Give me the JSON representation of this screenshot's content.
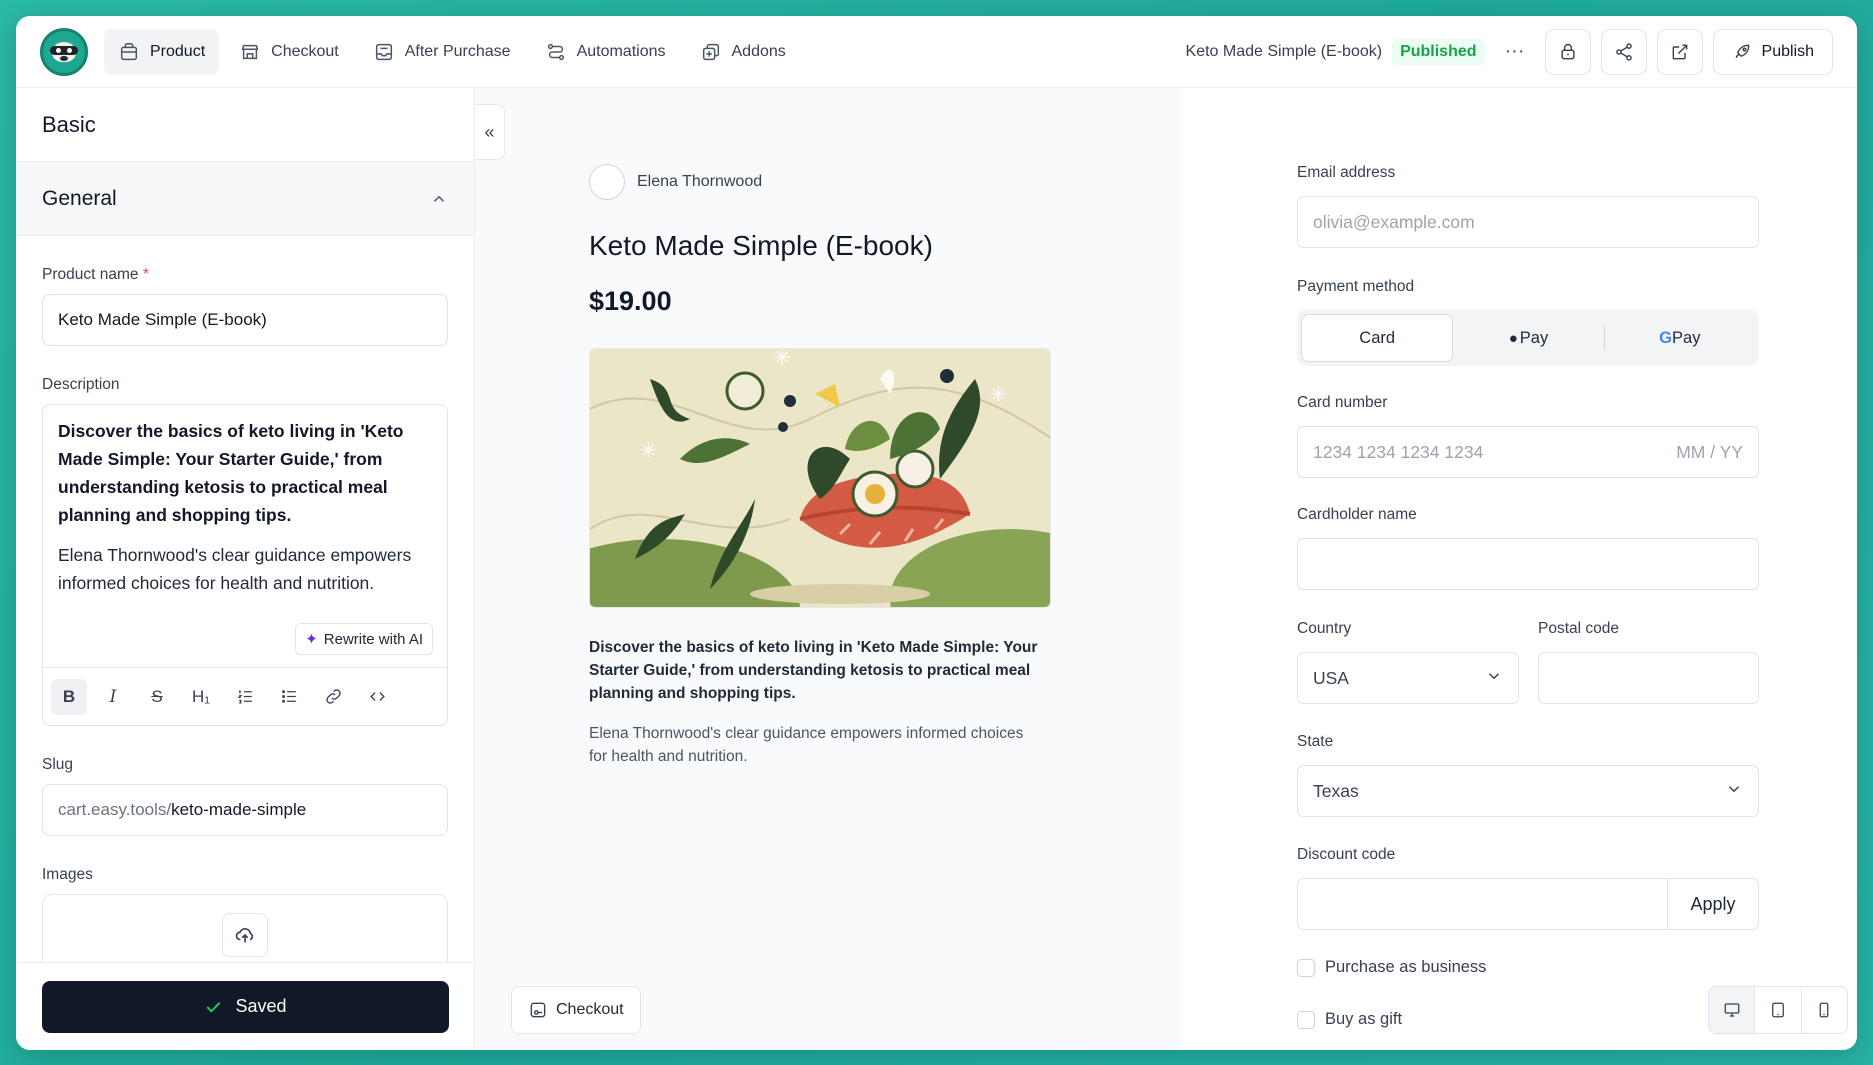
{
  "topbar": {
    "nav": [
      {
        "label": "Product",
        "icon": "bag-icon",
        "active": true
      },
      {
        "label": "Checkout",
        "icon": "store-icon",
        "active": false
      },
      {
        "label": "After Purchase",
        "icon": "inbox-icon",
        "active": false
      },
      {
        "label": "Automations",
        "icon": "flow-icon",
        "active": false
      },
      {
        "label": "Addons",
        "icon": "addon-icon",
        "active": false
      }
    ],
    "product_title": "Keto Made Simple (E-book)",
    "status": "Published",
    "more": "···",
    "publish_label": "Publish"
  },
  "left": {
    "section_title": "Basic",
    "group_title": "General",
    "product_name_label": "Product name",
    "required_mark": "*",
    "product_name_value": "Keto Made Simple (E-book)",
    "description_label": "Description",
    "description_p1": "Discover the basics of keto living in 'Keto Made Simple: Your Starter Guide,' from understanding ketosis to practical meal planning and shopping tips.",
    "description_p2": "Elena Thornwood's clear guidance empowers informed choices for health and nutrition.",
    "rewrite_label": "Rewrite with AI",
    "toolbar": {
      "bold": "B",
      "italic": "I",
      "strike": "S",
      "heading": "H₁"
    },
    "slug_label": "Slug",
    "slug_prefix": "cart.easy.tools/",
    "slug_value": "keto-made-simple",
    "images_label": "Images",
    "saved_label": "Saved",
    "collapse": "«"
  },
  "preview": {
    "author": "Elena Thornwood",
    "title": "Keto Made Simple (E-book)",
    "price": "$19.00",
    "description_p1": "Discover the basics of keto living in 'Keto Made Simple: Your Starter Guide,' from understanding ketosis to practical meal planning and shopping tips.",
    "description_p2": "Elena Thornwood's clear guidance empowers informed choices for health and nutrition.",
    "checkout_label": "Checkout"
  },
  "checkout_form": {
    "email_label": "Email address",
    "email_placeholder": "olivia@example.com",
    "payment_label": "Payment method",
    "payment_options": [
      "Card",
      "Pay",
      "Pay"
    ],
    "gpay_g": "G",
    "card_label": "Card number",
    "card_placeholder": "1234 1234 1234 1234",
    "card_expiry": "MM / YY",
    "cardholder_label": "Cardholder name",
    "country_label": "Country",
    "country_value": "USA",
    "postal_label": "Postal code",
    "state_label": "State",
    "state_value": "Texas",
    "discount_label": "Discount code",
    "apply_label": "Apply",
    "business_label": "Purchase as business",
    "gift_label": "Buy as gift"
  },
  "colors": {
    "accent_green": "#16a34a",
    "background": "#1fa99a",
    "saved_button": "#111827"
  }
}
